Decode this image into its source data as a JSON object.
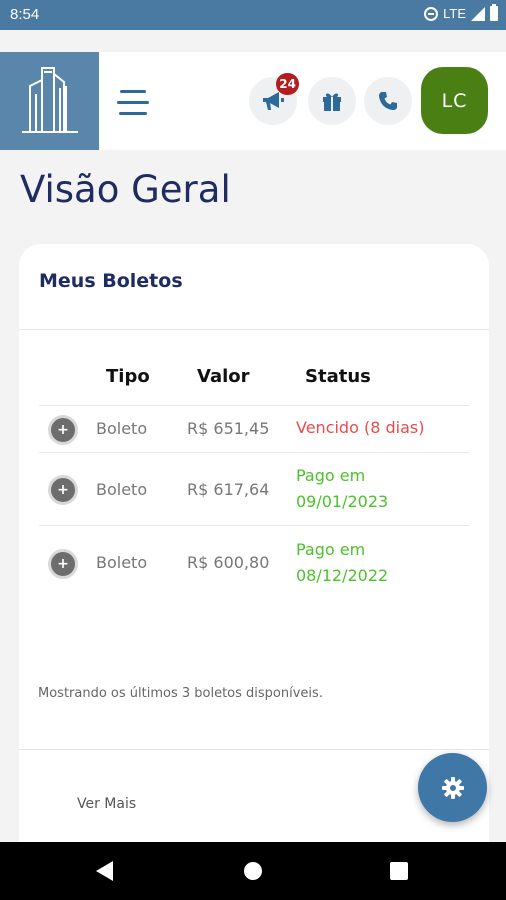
{
  "status_bar": {
    "time": "8:54",
    "network": "LTE"
  },
  "header": {
    "notification_count": "24",
    "avatar_initials": "LC"
  },
  "page": {
    "title": "Visão Geral"
  },
  "boletos_card": {
    "title": "Meus Boletos",
    "columns": [
      "Tipo",
      "Valor",
      "Status"
    ],
    "rows": [
      {
        "tipo": "Boleto",
        "valor": "R$ 651,45",
        "status_line1": "Vencido (8 dias)",
        "status_line2": "",
        "status_color": "#e94b4b"
      },
      {
        "tipo": "Boleto",
        "valor": "R$ 617,64",
        "status_line1": "Pago em",
        "status_line2": "09/01/2023",
        "status_color": "#4cc22a"
      },
      {
        "tipo": "Boleto",
        "valor": "R$ 600,80",
        "status_line1": "Pago em",
        "status_line2": "08/12/2022",
        "status_color": "#4cc22a"
      }
    ],
    "footer_note": "Mostrando os últimos 3 boletos disponíveis.",
    "ver_mais": "Ver Mais"
  },
  "icons": {
    "logo": "building-logo-icon",
    "menu": "hamburger-icon",
    "announcements": "megaphone-icon",
    "gifts": "gift-icon",
    "phone": "phone-icon",
    "settings": "gear-icon",
    "row_expand": "plus-circle-icon"
  },
  "colors": {
    "brand": "#4a7aa2",
    "title": "#1f2c61",
    "overdue": "#e94b4b",
    "paid": "#4cc22a",
    "avatar": "#4a7f14",
    "badge": "#b31d1d"
  }
}
